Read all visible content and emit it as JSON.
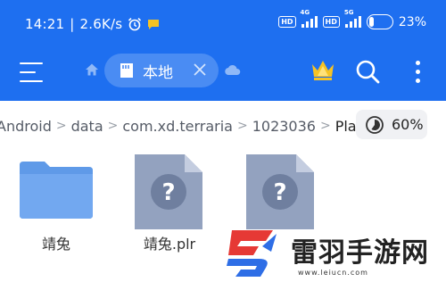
{
  "status_bar": {
    "time": "14:21",
    "speed": "2.6K/s",
    "net1": "4G",
    "net2": "5G",
    "hd": "HD",
    "battery": "23%"
  },
  "app_bar": {
    "location_chip": "本地",
    "icons": [
      "menu-icon",
      "home-icon",
      "sd-card-icon",
      "close-icon",
      "cloud-icon",
      "crown-icon",
      "search-icon",
      "more-icon"
    ]
  },
  "breadcrumb": [
    "Android",
    "data",
    "com.xd.terraria",
    "1023036",
    "Players"
  ],
  "storage": {
    "percent": "60%",
    "fill_fraction": 0.6
  },
  "files": [
    {
      "name": "靖兔",
      "type": "folder"
    },
    {
      "name": "靖兔.plr",
      "type": "unknown-file"
    },
    {
      "name": "",
      "type": "unknown-file"
    }
  ],
  "watermark": {
    "text": "雷羽手游网",
    "url": "www.leiucn.com"
  },
  "colors": {
    "primary": "#1e6ff0",
    "chip": "#4a8cf3",
    "folder": "#5f9ae8",
    "file": "#93a2bf",
    "crown": "#f6c324",
    "logo_red": "#e63935",
    "logo_blue": "#2e6ee6"
  }
}
